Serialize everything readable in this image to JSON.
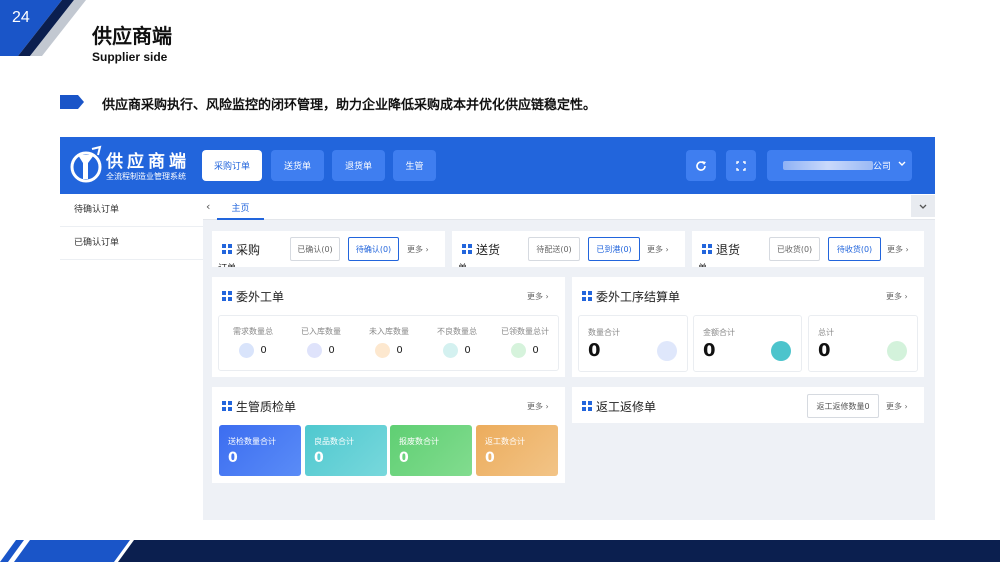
{
  "slide": {
    "page_number": "24",
    "title": "供应商端",
    "subtitle": "Supplier side",
    "bullet": "供应商采购执行、风险监控的闭环管理，助力企业降低采购成本并优化供应链稳定性。"
  },
  "app": {
    "logo_title": "供应商端",
    "logo_subtitle": "全流程制造业管理系统",
    "nav": [
      "采购订单",
      "送货单",
      "退货单",
      "生管"
    ],
    "user_suffix": "公司",
    "sidebar": [
      "待确认订单",
      "已确认订单"
    ],
    "tab_home": "主页",
    "more": "更多",
    "purchase": {
      "title": "采购",
      "wrap": "订单",
      "pills": [
        "已确认(0)",
        "待确认(0)"
      ]
    },
    "delivery": {
      "title": "送货",
      "wrap": "单",
      "pills": [
        "待配送(0)",
        "已到港(0)"
      ]
    },
    "returns": {
      "title": "退货",
      "wrap": "单",
      "pills": [
        "已收货(0)",
        "待收货(0)"
      ]
    },
    "outsource": {
      "title": "委外工单",
      "stats": [
        {
          "label": "需求数量总",
          "value": "0"
        },
        {
          "label": "已入库数量",
          "value": "0"
        },
        {
          "label": "未入库数量",
          "value": "0"
        },
        {
          "label": "不良数量总",
          "value": "0"
        },
        {
          "label": "已领数量总计",
          "value": "0"
        }
      ]
    },
    "settlement": {
      "title": "委外工序结算单",
      "items": [
        {
          "label": "数量合计",
          "value": "0"
        },
        {
          "label": "金额合计",
          "value": "0"
        },
        {
          "label": "总计",
          "value": "0"
        }
      ]
    },
    "qc": {
      "title": "生管质检单",
      "tiles": [
        {
          "label": "送检数量合计",
          "value": "0"
        },
        {
          "label": "良品数合计",
          "value": "0"
        },
        {
          "label": "报废数合计",
          "value": "0"
        },
        {
          "label": "返工数合计",
          "value": "0"
        }
      ]
    },
    "rework": {
      "title": "返工返修单",
      "field": "返工返修数量0"
    }
  },
  "colors": {
    "brand_blue": "#2265dc",
    "dark_navy": "#0b1f4f",
    "qc_tiles": [
      "#3c6df0",
      "#4fc8cf",
      "#5fcf73",
      "#ecac5c"
    ]
  }
}
